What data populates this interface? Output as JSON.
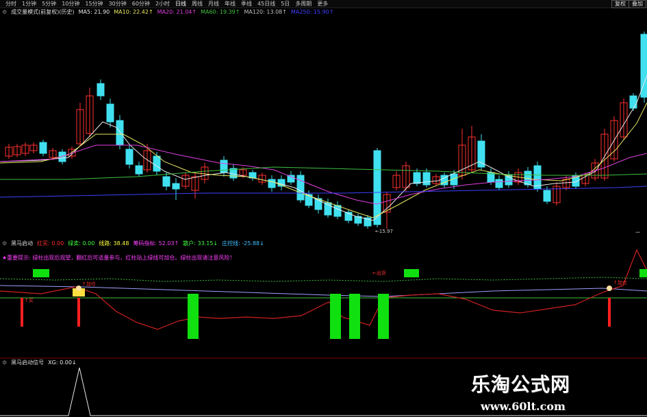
{
  "toolbar": {
    "tabs": [
      "分时",
      "1分钟",
      "5分钟",
      "10分钟",
      "15分钟",
      "30分钟",
      "60分钟",
      "2小时",
      "日线",
      "周线",
      "月线",
      "年线",
      "季线",
      "45日线",
      "5日",
      "多周期",
      "更多"
    ],
    "active_tab": "日线",
    "right_buttons": [
      "复权",
      "叠加"
    ]
  },
  "main_chart": {
    "indicator_name": "成交量模式(前复权)(历史)",
    "ma_values": [
      {
        "label": "MA5: 21.90",
        "color": "#e8e8e8"
      },
      {
        "label": "MA10: 22.42↑",
        "color": "#e8e860"
      },
      {
        "label": "MA20: 21.04↑",
        "color": "#e040e0"
      },
      {
        "label": "MA60: 19.39↑",
        "color": "#40c040"
      },
      {
        "label": "MA120: 13.08↑",
        "color": "#c0c0c0"
      },
      {
        "label": "MA250: 15.90↑",
        "color": "#4040ff"
      }
    ],
    "low_label": "←15.97",
    "right_label": "前",
    "candle_colors": {
      "up": "#ff3030",
      "down": "#40e0f0"
    }
  },
  "sub_chart1": {
    "name": "黑马启动",
    "items": [
      {
        "label": "红买: 0.00",
        "color": "#ff3030"
      },
      {
        "label": "绿卖: 0.00",
        "color": "#40ff40"
      },
      {
        "label": "线路: 38.48",
        "color": "#ffff40"
      },
      {
        "label": "筹码指标: 52.03↑",
        "color": "#ff40ff"
      },
      {
        "label": "散户: 33.15↓",
        "color": "#40ff40"
      },
      {
        "label": "庄控线: -25.88↓",
        "color": "#40c0ff"
      }
    ],
    "note": "★重要提示: 绿柱出现后观望，翻红后可适量参与，红柱站上绿线可加仓。绿柱出现请注意风险！",
    "signal_labels": [
      "↑买",
      "↑加仓",
      "←出货",
      "↑出货",
      "↑买",
      "↑加仓"
    ]
  },
  "sub_chart2": {
    "name": "黑马启动信号",
    "value": "XG: 0.00↓"
  },
  "watermark": {
    "title": "乐淘公式网",
    "url": "www.60lt.com"
  }
}
